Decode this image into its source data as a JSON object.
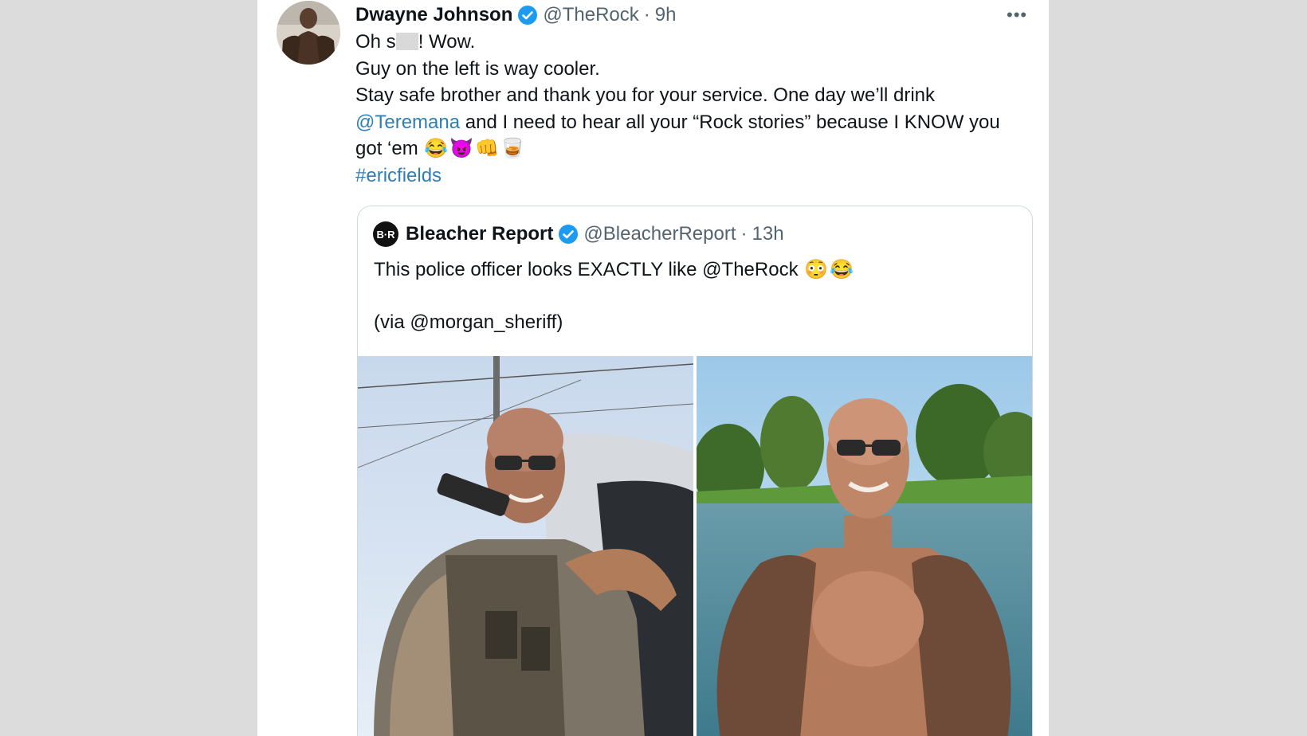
{
  "tweet": {
    "author_name": "Dwayne Johnson",
    "author_handle": "@TheRock",
    "separator": "·",
    "time": "9h",
    "more_label": "•••",
    "line1_start": "Oh s",
    "line1_end": "! Wow.",
    "line2": "Guy on the left is way cooler.",
    "line3": "Stay safe brother and thank you for your service. One day we’ll drink",
    "mention": "@Teremana",
    "line4_rest": " and I need to hear all your “Rock stories” because I KNOW you",
    "line5": "got ‘em ",
    "emojis": [
      "😂",
      "😈",
      "👊",
      "🥃"
    ],
    "hashtag": "#ericfields"
  },
  "quoted": {
    "logo_text": "B·R",
    "author_name": "Bleacher Report",
    "author_handle": "@BleacherReport",
    "separator": "·",
    "time": "13h",
    "text_line1": "This police officer looks EXACTLY like @TheRock ",
    "text_emojis": [
      "😳",
      "😂"
    ],
    "text_line2": "(via @morgan_sheriff)"
  },
  "colors": {
    "link": "#2f7fb5",
    "verified": "#1d9bf0",
    "background": "#dcdcdc"
  }
}
